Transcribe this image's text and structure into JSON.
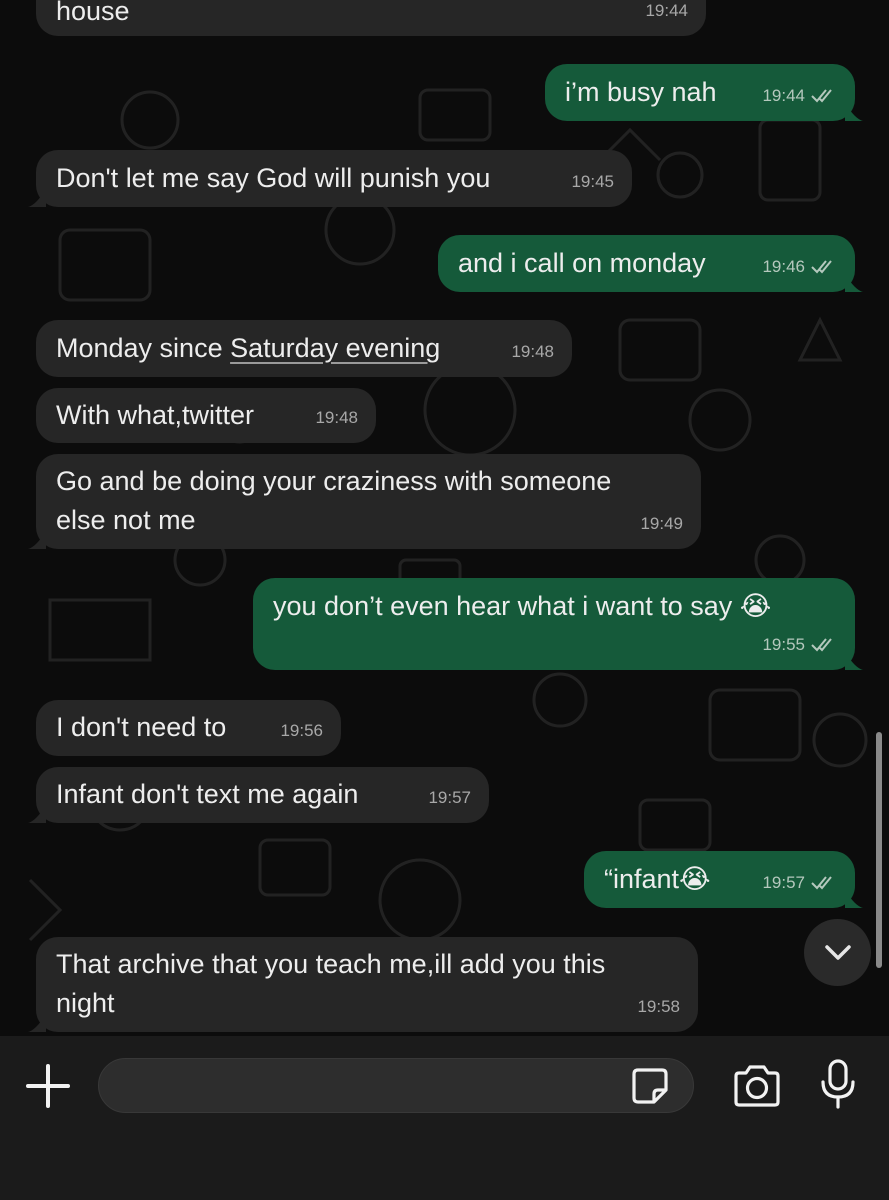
{
  "messages": [
    {
      "dir": "in",
      "text": "house",
      "time": "19:44"
    },
    {
      "dir": "out",
      "text": "i’m busy nah",
      "time": "19:44"
    },
    {
      "dir": "in",
      "text": "Don't let me say God will punish you",
      "time": "19:45"
    },
    {
      "dir": "out",
      "text": "and i call on monday",
      "time": "19:46"
    },
    {
      "dir": "in",
      "text_before": "Monday since ",
      "text_link": "Saturday evening",
      "time": "19:48"
    },
    {
      "dir": "in",
      "text": "With what,twitter",
      "time": "19:48"
    },
    {
      "dir": "in",
      "line1": "Go and be doing your craziness with someone",
      "line2": "else not me",
      "time": "19:49"
    },
    {
      "dir": "out",
      "text": "you don’t even hear what i want to say 😭",
      "time": "19:55"
    },
    {
      "dir": "in",
      "text": "I don't need to",
      "time": "19:56"
    },
    {
      "dir": "in",
      "text": "Infant don't text me again",
      "time": "19:57"
    },
    {
      "dir": "out",
      "text": "“infant😭",
      "time": "19:57"
    },
    {
      "dir": "in",
      "line1": "That archive that you teach me,ill add you this",
      "line2": "night",
      "time": "19:58"
    }
  ],
  "composer": {
    "value": "",
    "placeholder": ""
  },
  "icons": {
    "attach": "plus-icon",
    "sticker": "sticker-icon",
    "camera": "camera-icon",
    "mic": "microphone-icon",
    "scroll": "chevron-down-icon",
    "read": "double-check-icon"
  },
  "colors": {
    "incoming_bubble": "#262626",
    "outgoing_bubble": "#155a3a",
    "background": "#0c0c0c",
    "input_bar": "#1b1b1b"
  }
}
